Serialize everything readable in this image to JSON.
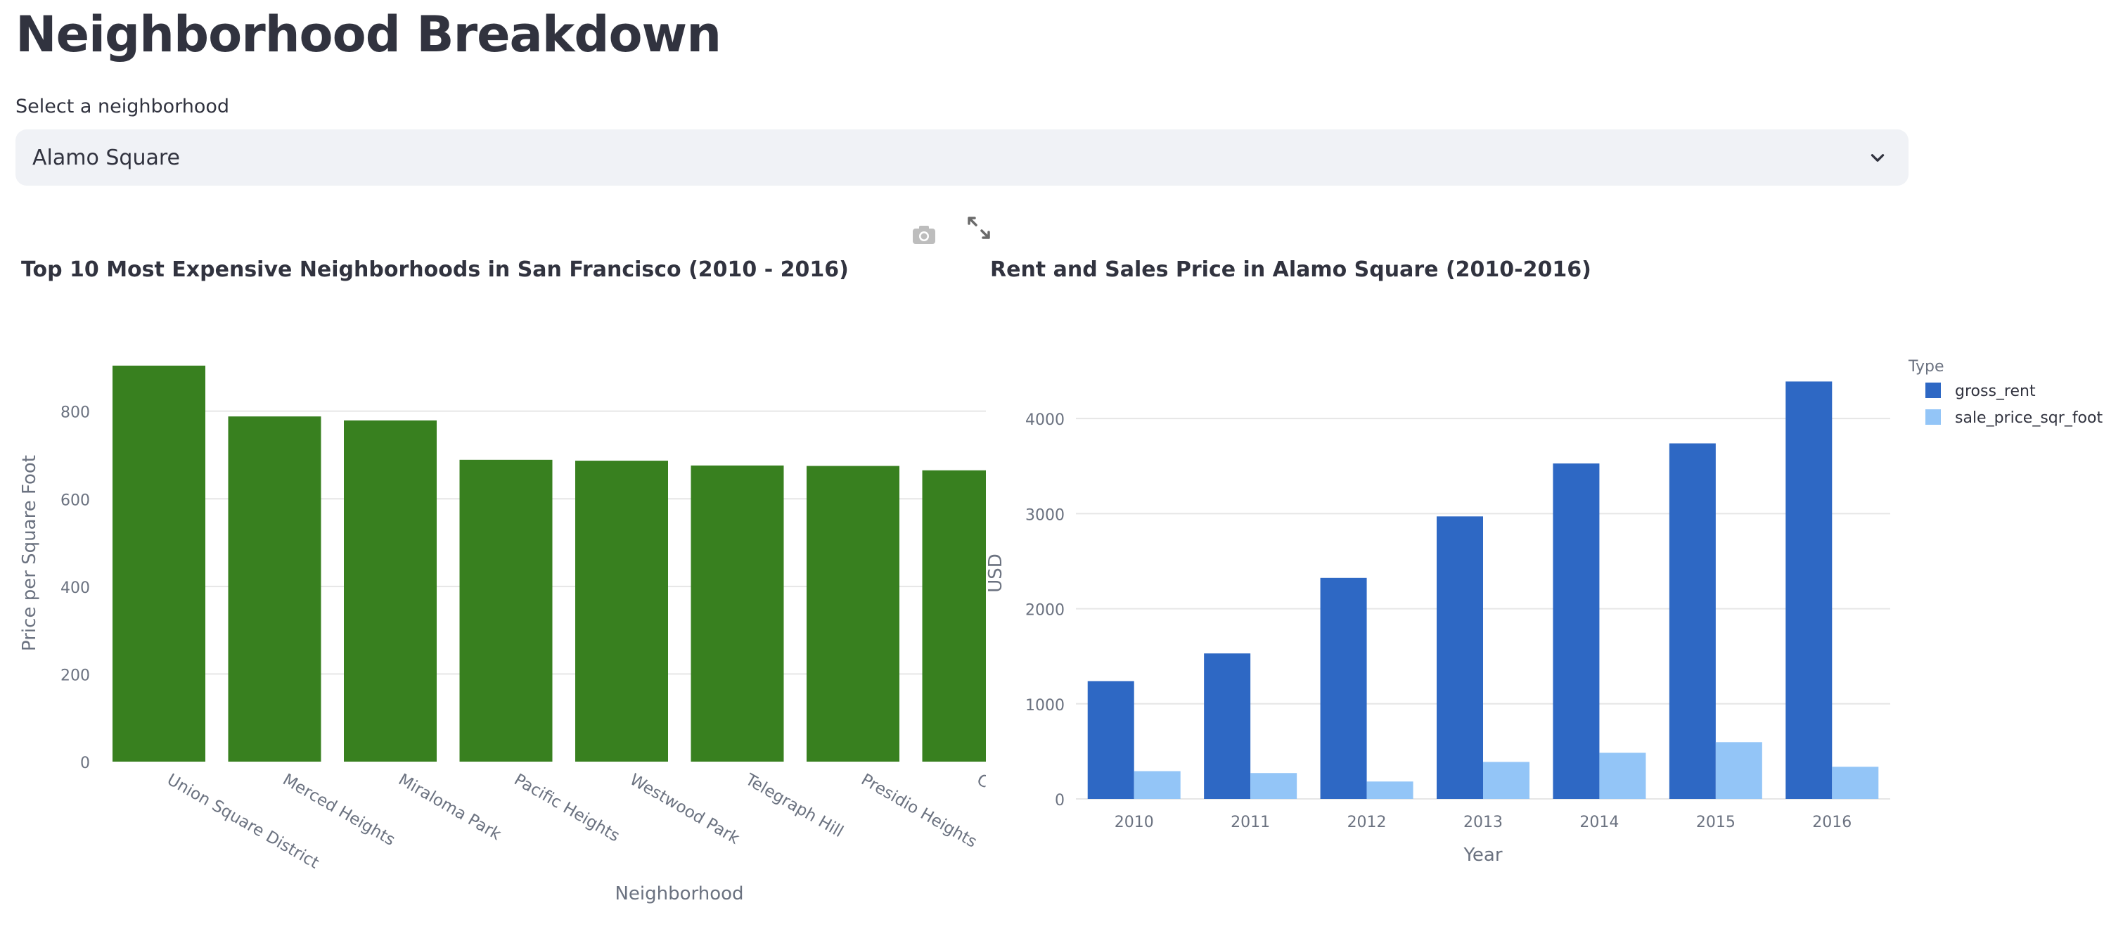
{
  "page": {
    "title": "Neighborhood Breakdown",
    "select_label": "Select a neighborhood",
    "selected_value": "Alamo Square"
  },
  "toolbar": {
    "camera_icon": "camera-icon",
    "fullscreen_icon": "expand-icon"
  },
  "colors": {
    "green_bar": "#38801f",
    "gross_rent": "#2e68c4",
    "sale_price": "#93c5f7",
    "axis_text": "#6b7280",
    "grid": "#e6e6e6"
  },
  "chart_data": [
    {
      "type": "bar",
      "title": "Top 10 Most Expensive Neighborhoods in San Francisco (2010 - 2016)",
      "xlabel": "Neighborhood",
      "ylabel": "Price per Square Foot",
      "categories": [
        "Union Square District",
        "Merced Heights",
        "Miraloma Park",
        "Pacific Heights",
        "Westwood Park",
        "Telegraph Hill",
        "Presidio Heights",
        "Co"
      ],
      "values": [
        904,
        788,
        779,
        689,
        687,
        676,
        675,
        665
      ],
      "yticks": [
        0,
        200,
        400,
        600,
        800
      ],
      "ylim": [
        0,
        952
      ],
      "grid": true
    },
    {
      "type": "bar",
      "title": "Rent and Sales Price in Alamo Square (2010-2016)",
      "xlabel": "Year",
      "ylabel": "USD",
      "legend_title": "Type",
      "legend_position": "top-right",
      "categories": [
        "2010",
        "2011",
        "2012",
        "2013",
        "2014",
        "2015",
        "2016"
      ],
      "series": [
        {
          "name": "gross_rent",
          "values": [
            1239,
            1530,
            2324,
            2971,
            3528,
            3739,
            4390
          ]
        },
        {
          "name": "sale_price_sqr_foot",
          "values": [
            292,
            272,
            183,
            389,
            485,
            597,
            338
          ]
        }
      ],
      "yticks": [
        0,
        1000,
        2000,
        3000,
        4000
      ],
      "ylim": [
        0,
        4630
      ],
      "grid": true
    }
  ]
}
